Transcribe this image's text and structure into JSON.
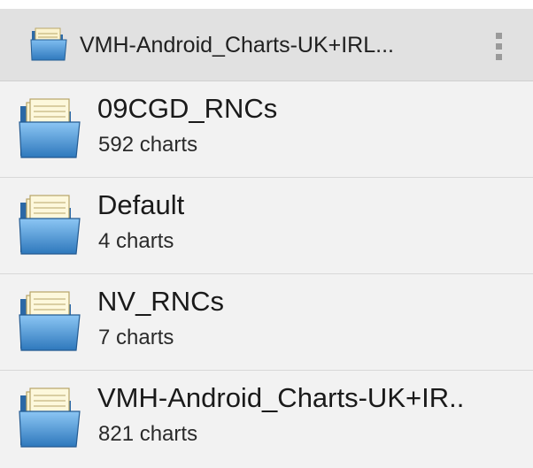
{
  "action_bar": {
    "title": "VMH-Android_Charts-UK+IRL...",
    "icon": "folder-icon",
    "overflow_icon": "overflow-menu-icon"
  },
  "folders": [
    {
      "name": "09CGD_RNCs",
      "count": "592 charts",
      "icon": "folder-icon"
    },
    {
      "name": "Default",
      "count": "4 charts",
      "icon": "folder-icon"
    },
    {
      "name": "NV_RNCs",
      "count": "7 charts",
      "icon": "folder-icon"
    },
    {
      "name": "VMH-Android_Charts-UK+IR..",
      "count": "821 charts",
      "icon": "folder-icon"
    }
  ],
  "colors": {
    "action_bar_bg": "#e1e1e1",
    "list_bg": "#f2f2f2",
    "folder_blue": "#3d86c6",
    "folder_front": "#6fb0e6",
    "paper": "#f3e7b0"
  }
}
